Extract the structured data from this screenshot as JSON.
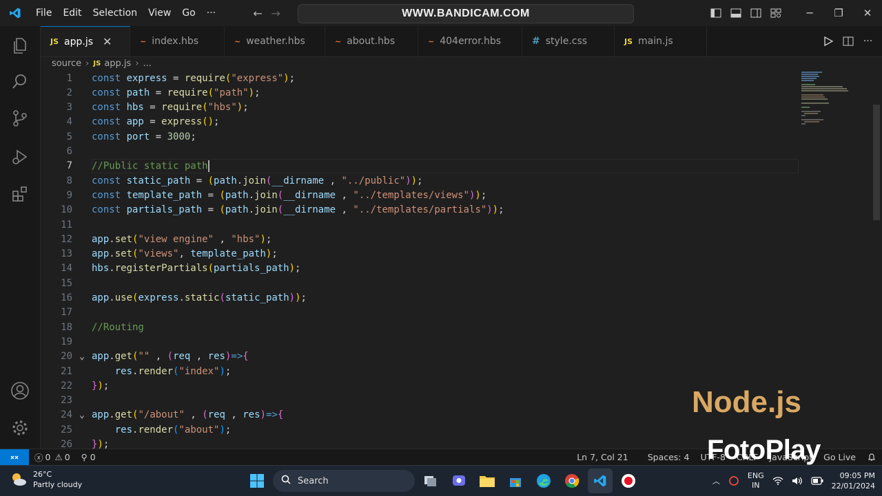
{
  "titlebar": {
    "menu": [
      "File",
      "Edit",
      "Selection",
      "View",
      "Go",
      "···"
    ],
    "command_center": "WWW.BANDICAM.COM"
  },
  "tabs": [
    {
      "label": "app.js",
      "icon": "JS",
      "icon_color": "#e8d44d",
      "active": true
    },
    {
      "label": "index.hbs",
      "icon": "~",
      "icon_color": "#f0762d",
      "active": false
    },
    {
      "label": "weather.hbs",
      "icon": "~",
      "icon_color": "#f0762d",
      "active": false
    },
    {
      "label": "about.hbs",
      "icon": "~",
      "icon_color": "#f0762d",
      "active": false
    },
    {
      "label": "404error.hbs",
      "icon": "~",
      "icon_color": "#f0762d",
      "active": false
    },
    {
      "label": "style.css",
      "icon": "#",
      "icon_color": "#519aba",
      "active": false
    },
    {
      "label": "main.js",
      "icon": "JS",
      "icon_color": "#e8d44d",
      "active": false
    }
  ],
  "breadcrumb": {
    "folder": "source",
    "file_icon": "JS",
    "file": "app.js",
    "more": "..."
  },
  "editor": {
    "current_line": 7,
    "lines": [
      {
        "n": "1",
        "fold": "",
        "tokens": [
          [
            "k",
            "const "
          ],
          [
            "v",
            "express"
          ],
          [
            "p",
            " = "
          ],
          [
            "f",
            "require"
          ],
          [
            "b1",
            "("
          ],
          [
            "s",
            "\"express\""
          ],
          [
            "b1",
            ")"
          ],
          [
            "p",
            ";"
          ]
        ]
      },
      {
        "n": "2",
        "fold": "",
        "tokens": [
          [
            "k",
            "const "
          ],
          [
            "v",
            "path"
          ],
          [
            "p",
            " = "
          ],
          [
            "f",
            "require"
          ],
          [
            "b1",
            "("
          ],
          [
            "s",
            "\"path\""
          ],
          [
            "b1",
            ")"
          ],
          [
            "p",
            ";"
          ]
        ]
      },
      {
        "n": "3",
        "fold": "",
        "tokens": [
          [
            "k",
            "const "
          ],
          [
            "v",
            "hbs"
          ],
          [
            "p",
            " = "
          ],
          [
            "f",
            "require"
          ],
          [
            "b1",
            "("
          ],
          [
            "s",
            "\"hbs\""
          ],
          [
            "b1",
            ")"
          ],
          [
            "p",
            ";"
          ]
        ]
      },
      {
        "n": "4",
        "fold": "",
        "tokens": [
          [
            "k",
            "const "
          ],
          [
            "v",
            "app"
          ],
          [
            "p",
            " = "
          ],
          [
            "f",
            "express"
          ],
          [
            "b1",
            "()"
          ],
          [
            "p",
            ";"
          ]
        ]
      },
      {
        "n": "5",
        "fold": "",
        "tokens": [
          [
            "k",
            "const "
          ],
          [
            "v",
            "port"
          ],
          [
            "p",
            " = "
          ],
          [
            "n",
            "3000"
          ],
          [
            "p",
            ";"
          ]
        ]
      },
      {
        "n": "6",
        "fold": "",
        "tokens": []
      },
      {
        "n": "7",
        "fold": "",
        "tokens": [
          [
            "c",
            "//Public static path"
          ]
        ]
      },
      {
        "n": "8",
        "fold": "",
        "tokens": [
          [
            "k",
            "const "
          ],
          [
            "v",
            "static_path"
          ],
          [
            "p",
            " = "
          ],
          [
            "b1",
            "("
          ],
          [
            "v",
            "path"
          ],
          [
            "p",
            "."
          ],
          [
            "f",
            "join"
          ],
          [
            "b2",
            "("
          ],
          [
            "v",
            "__dirname"
          ],
          [
            "p",
            " , "
          ],
          [
            "s",
            "\"../public\""
          ],
          [
            "b2",
            ")"
          ],
          [
            "b1",
            ")"
          ],
          [
            "p",
            ";"
          ]
        ]
      },
      {
        "n": "9",
        "fold": "",
        "tokens": [
          [
            "k",
            "const "
          ],
          [
            "v",
            "template_path"
          ],
          [
            "p",
            " = "
          ],
          [
            "b1",
            "("
          ],
          [
            "v",
            "path"
          ],
          [
            "p",
            "."
          ],
          [
            "f",
            "join"
          ],
          [
            "b2",
            "("
          ],
          [
            "v",
            "__dirname"
          ],
          [
            "p",
            " , "
          ],
          [
            "s",
            "\"../templates/views\""
          ],
          [
            "b2",
            ")"
          ],
          [
            "b1",
            ")"
          ],
          [
            "p",
            ";"
          ]
        ]
      },
      {
        "n": "10",
        "fold": "",
        "tokens": [
          [
            "k",
            "const "
          ],
          [
            "v",
            "partials_path"
          ],
          [
            "p",
            " = "
          ],
          [
            "b1",
            "("
          ],
          [
            "v",
            "path"
          ],
          [
            "p",
            "."
          ],
          [
            "f",
            "join"
          ],
          [
            "b2",
            "("
          ],
          [
            "v",
            "__dirname"
          ],
          [
            "p",
            " , "
          ],
          [
            "s",
            "\"../templates/partials\""
          ],
          [
            "b2",
            ")"
          ],
          [
            "b1",
            ")"
          ],
          [
            "p",
            ";"
          ]
        ]
      },
      {
        "n": "11",
        "fold": "",
        "tokens": []
      },
      {
        "n": "12",
        "fold": "",
        "tokens": [
          [
            "v",
            "app"
          ],
          [
            "p",
            "."
          ],
          [
            "f",
            "set"
          ],
          [
            "b1",
            "("
          ],
          [
            "s",
            "\"view engine\""
          ],
          [
            "p",
            " , "
          ],
          [
            "s",
            "\"hbs\""
          ],
          [
            "b1",
            ")"
          ],
          [
            "p",
            ";"
          ]
        ]
      },
      {
        "n": "13",
        "fold": "",
        "tokens": [
          [
            "v",
            "app"
          ],
          [
            "p",
            "."
          ],
          [
            "f",
            "set"
          ],
          [
            "b1",
            "("
          ],
          [
            "s",
            "\"views\""
          ],
          [
            "p",
            ", "
          ],
          [
            "v",
            "template_path"
          ],
          [
            "b1",
            ")"
          ],
          [
            "p",
            ";"
          ]
        ]
      },
      {
        "n": "14",
        "fold": "",
        "tokens": [
          [
            "v",
            "hbs"
          ],
          [
            "p",
            "."
          ],
          [
            "f",
            "registerPartials"
          ],
          [
            "b1",
            "("
          ],
          [
            "v",
            "partials_path"
          ],
          [
            "b1",
            ")"
          ],
          [
            "p",
            ";"
          ]
        ]
      },
      {
        "n": "15",
        "fold": "",
        "tokens": []
      },
      {
        "n": "16",
        "fold": "",
        "tokens": [
          [
            "v",
            "app"
          ],
          [
            "p",
            "."
          ],
          [
            "f",
            "use"
          ],
          [
            "b1",
            "("
          ],
          [
            "v",
            "express"
          ],
          [
            "p",
            "."
          ],
          [
            "f",
            "static"
          ],
          [
            "b2",
            "("
          ],
          [
            "v",
            "static_path"
          ],
          [
            "b2",
            ")"
          ],
          [
            "b1",
            ")"
          ],
          [
            "p",
            ";"
          ]
        ]
      },
      {
        "n": "17",
        "fold": "",
        "tokens": []
      },
      {
        "n": "18",
        "fold": "",
        "tokens": [
          [
            "c",
            "//Routing"
          ]
        ]
      },
      {
        "n": "19",
        "fold": "",
        "tokens": []
      },
      {
        "n": "20",
        "fold": "v",
        "tokens": [
          [
            "v",
            "app"
          ],
          [
            "p",
            "."
          ],
          [
            "f",
            "get"
          ],
          [
            "b1",
            "("
          ],
          [
            "s",
            "\"\""
          ],
          [
            "p",
            " , "
          ],
          [
            "b2",
            "("
          ],
          [
            "v",
            "req"
          ],
          [
            "p",
            " , "
          ],
          [
            "v",
            "res"
          ],
          [
            "b2",
            ")"
          ],
          [
            "k",
            "=>"
          ],
          [
            "b2",
            "{"
          ]
        ]
      },
      {
        "n": "21",
        "fold": "",
        "tokens": [
          [
            "p",
            "    "
          ],
          [
            "v",
            "res"
          ],
          [
            "p",
            "."
          ],
          [
            "f",
            "render"
          ],
          [
            "b3",
            "("
          ],
          [
            "s",
            "\"index\""
          ],
          [
            "b3",
            ")"
          ],
          [
            "p",
            ";"
          ]
        ]
      },
      {
        "n": "22",
        "fold": "",
        "tokens": [
          [
            "b2",
            "}"
          ],
          [
            "b1",
            ")"
          ],
          [
            "p",
            ";"
          ]
        ]
      },
      {
        "n": "23",
        "fold": "",
        "tokens": []
      },
      {
        "n": "24",
        "fold": "v",
        "tokens": [
          [
            "v",
            "app"
          ],
          [
            "p",
            "."
          ],
          [
            "f",
            "get"
          ],
          [
            "b1",
            "("
          ],
          [
            "s",
            "\"/about\""
          ],
          [
            "p",
            " , "
          ],
          [
            "b2",
            "("
          ],
          [
            "v",
            "req"
          ],
          [
            "p",
            " , "
          ],
          [
            "v",
            "res"
          ],
          [
            "b2",
            ")"
          ],
          [
            "k",
            "=>"
          ],
          [
            "b2",
            "{"
          ]
        ]
      },
      {
        "n": "25",
        "fold": "",
        "tokens": [
          [
            "p",
            "    "
          ],
          [
            "v",
            "res"
          ],
          [
            "p",
            "."
          ],
          [
            "f",
            "render"
          ],
          [
            "b3",
            "("
          ],
          [
            "s",
            "\"about\""
          ],
          [
            "b3",
            ")"
          ],
          [
            "p",
            ";"
          ]
        ]
      },
      {
        "n": "26",
        "fold": "",
        "tokens": [
          [
            "b2",
            "}"
          ],
          [
            "b1",
            ")"
          ],
          [
            "p",
            ";"
          ]
        ]
      }
    ]
  },
  "overlay": {
    "nodejs": "Node.js",
    "fotoplay": "FotoPlay"
  },
  "statusbar": {
    "errors": "0",
    "warnings": "0",
    "ports": "0",
    "position": "Ln 7, Col 21",
    "spaces": "Spaces: 4",
    "encoding": "UTF-8",
    "eol": "CRLF",
    "language": "JavaScript",
    "live": "Go Live"
  },
  "taskbar": {
    "temperature": "26°C",
    "weather": "Partly cloudy",
    "search": "Search",
    "lang1": "ENG",
    "lang2": "IN",
    "time": "09:05 PM",
    "date": "22/01/2024"
  }
}
